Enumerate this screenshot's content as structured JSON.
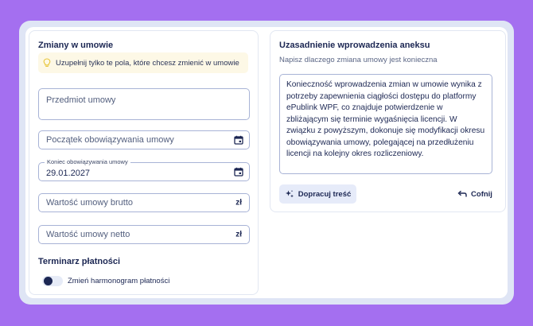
{
  "left": {
    "title": "Zmiany w umowie",
    "hint": "Uzupełnij tylko te pola, które chcesz zmienić w umowie",
    "fields": {
      "subject": {
        "placeholder": "Przedmiot umowy"
      },
      "start": {
        "placeholder": "Początek obowiązywania umowy"
      },
      "end": {
        "label": "Koniec obowiązywania umowy",
        "value": "29.01.2027"
      },
      "gross": {
        "placeholder": "Wartość umowy brutto",
        "suffix": "zł"
      },
      "net": {
        "placeholder": "Wartość umowy netto",
        "suffix": "zł"
      }
    },
    "schedule_title": "Terminarz płatności",
    "schedule_toggle_label": "Zmień harmonogram płatności",
    "schedule_toggle_on": false
  },
  "right": {
    "title": "Uzasadnienie wprowadzenia aneksu",
    "subtitle": "Napisz dlaczego zmiana umowy jest konieczna",
    "justification": "Konieczność wprowadzenia zmian w umowie wynika z potrzeby zapewnienia ciągłości dostępu do platformy ePublink WPF, co znajduje potwierdzenie w zbliżającym się terminie wygaśnięcia licencji. W związku z powyższym, dokonuje się modyfikacji okresu obowiązywania umowy, polegającej na przedłużeniu licencji na kolejny okres rozliczeniowy.",
    "improve_button": "Dopracuj treść",
    "undo_button": "Cofnij"
  },
  "colors": {
    "background": "#a46ff0",
    "frame": "#dfe5f5",
    "primary_text": "#1c2753",
    "field_border": "#a8b3d6",
    "hint_bg": "#fdf8e6",
    "hint_icon": "#e8c63a",
    "button_bg": "#e6ebf9"
  },
  "icons": [
    "lightbulb-icon",
    "calendar-icon",
    "sparkle-icon",
    "undo-icon"
  ]
}
